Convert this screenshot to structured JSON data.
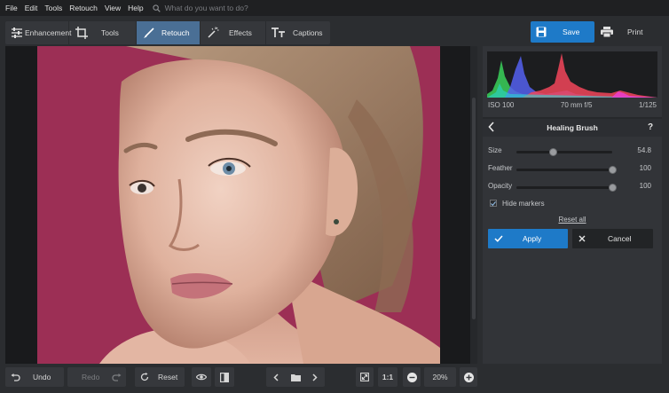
{
  "menu": {
    "items": [
      "File",
      "Edit",
      "Tools",
      "Retouch",
      "View",
      "Help"
    ],
    "search_placeholder": "What do you want to do?"
  },
  "toolbar": {
    "tabs": [
      {
        "label": "Enhancement",
        "icon": "sliders-icon"
      },
      {
        "label": "Tools",
        "icon": "crop-icon"
      },
      {
        "label": "Retouch",
        "icon": "brush-icon",
        "active": true
      },
      {
        "label": "Effects",
        "icon": "magic-wand-icon"
      },
      {
        "label": "Captions",
        "icon": "text-icon"
      }
    ],
    "save_label": "Save",
    "print_label": "Print"
  },
  "panel": {
    "meta": {
      "iso": "ISO 100",
      "lens": "70 mm f/5",
      "shutter": "1/125"
    },
    "title": "Healing Brush",
    "help": "?",
    "sliders": [
      {
        "label": "Size",
        "value": "54.8",
        "level": 0.38
      },
      {
        "label": "Feather",
        "value": "100",
        "level": 1.0
      },
      {
        "label": "Opacity",
        "value": "100",
        "level": 1.0
      }
    ],
    "hide_markers_label": "Hide markers",
    "hide_markers_checked": true,
    "reset_all_label": "Reset all",
    "apply_label": "Apply",
    "cancel_label": "Cancel"
  },
  "bottom": {
    "undo_label": "Undo",
    "redo_label": "Redo",
    "reset_label": "Reset",
    "one_to_one_label": "1:1",
    "zoom_value": "20%"
  },
  "colors": {
    "accent": "#1e7ac8",
    "active_tab": "#4a6f95",
    "backdrop": "#9a2f54"
  }
}
